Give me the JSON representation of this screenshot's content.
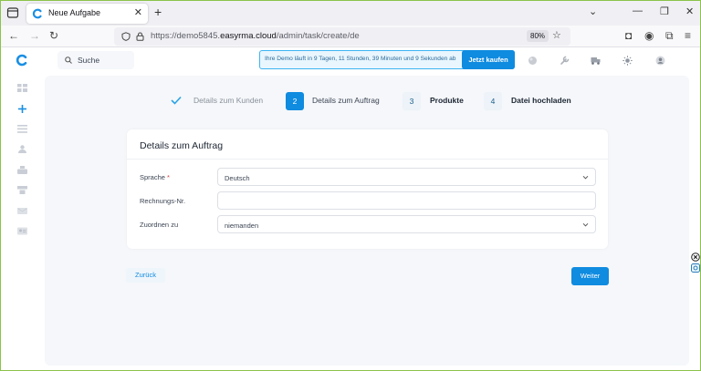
{
  "browser": {
    "tab_title": "Neue Aufgabe",
    "url_host_prefix": "https://demo5845.",
    "url_host_domain": "easyrma.cloud",
    "url_path": "/admin/task/create/de",
    "zoom": "80%"
  },
  "header": {
    "search_placeholder": "Suche",
    "demo_text": "Ihre Demo läuft in 9 Tagen, 11 Stunden, 39 Minuten und 9 Sekunden ab",
    "buy_label": "Jetzt kaufen"
  },
  "steps": [
    {
      "number": "✓",
      "label": "Details zum Kunden",
      "state": "done"
    },
    {
      "number": "2",
      "label": "Details zum Auftrag",
      "state": "active"
    },
    {
      "number": "3",
      "label": "Produkte",
      "state": "pending"
    },
    {
      "number": "4",
      "label": "Datei hochladen",
      "state": "pending"
    }
  ],
  "form": {
    "title": "Details zum Auftrag",
    "fields": [
      {
        "label": "Sprache",
        "required_mark": "*",
        "value": "Deutsch",
        "type": "select"
      },
      {
        "label": "Rechnungs-Nr.",
        "required_mark": "",
        "value": "",
        "type": "text"
      },
      {
        "label": "Zuordnen zu",
        "required_mark": "",
        "value": "niemanden",
        "type": "select"
      }
    ]
  },
  "actions": {
    "back_label": "Zurück",
    "next_label": "Weiter"
  },
  "colors": {
    "accent": "#0f8be0",
    "step_done": "#2aa3e6",
    "required": "#e53935"
  },
  "icons": {
    "sidebar": [
      "dashboard-icon",
      "plus-icon",
      "list-icon",
      "person-icon",
      "package-icon",
      "cards-icon",
      "mail-icon",
      "contact-icon"
    ],
    "header": [
      "puzzle-icon",
      "wrench-icon",
      "truck-icon",
      "sun-icon",
      "user-icon"
    ]
  }
}
